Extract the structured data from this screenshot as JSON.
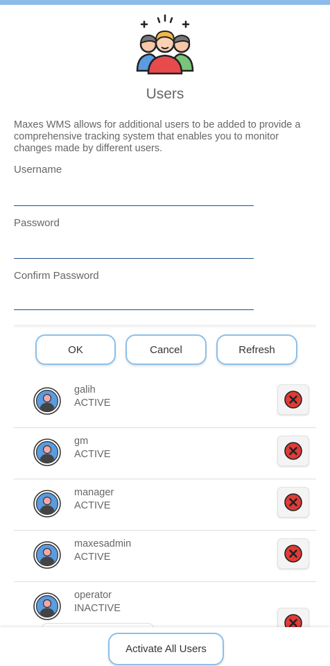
{
  "header": {
    "title": "Users",
    "hero_icon": "users-group-icon"
  },
  "description": "Maxes WMS allows for additional users to be added to provide a comprehensive tracking system that enables you to monitor changes made by different users.",
  "form": {
    "username_label": "Username",
    "username_value": "",
    "password_label": "Password",
    "password_value": "",
    "confirm_label": "Confirm Password",
    "confirm_value": ""
  },
  "actions": {
    "ok_label": "OK",
    "cancel_label": "Cancel",
    "refresh_label": "Refresh"
  },
  "users": [
    {
      "name": "galih",
      "status": "ACTIVE"
    },
    {
      "name": "gm",
      "status": "ACTIVE"
    },
    {
      "name": "manager",
      "status": "ACTIVE"
    },
    {
      "name": "maxesadmin",
      "status": "ACTIVE"
    },
    {
      "name": "operator",
      "status": "INACTIVE"
    }
  ],
  "footer": {
    "activate_all_label": "Activate All Users"
  },
  "colors": {
    "accent": "#8dbfe9",
    "underline": "#1c4f8a",
    "delete_red": "#e03b37",
    "avatar_blue": "#5b9be0"
  }
}
